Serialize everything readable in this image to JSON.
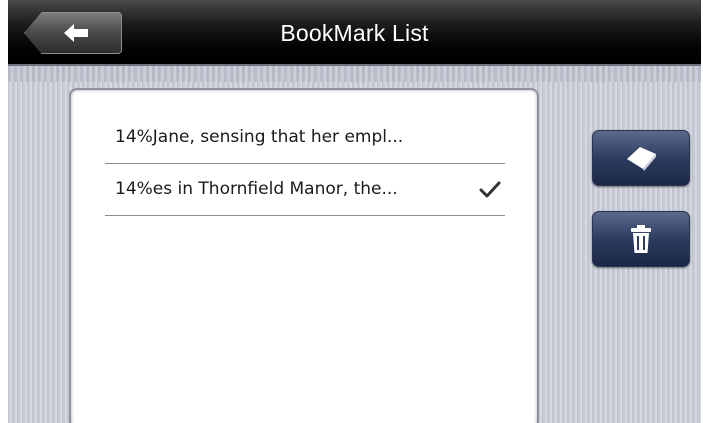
{
  "header": {
    "title": "BookMark List",
    "back_icon": "back-arrow-icon"
  },
  "bookmarks": [
    {
      "text": "14%Jane, sensing that her empl...",
      "checked": false
    },
    {
      "text": "14%es in Thornfield Manor, the...",
      "checked": true
    }
  ],
  "actions": {
    "add_icon": "bookmark-add-icon",
    "delete_icon": "trash-icon"
  },
  "colors": {
    "header_bg": "#000000",
    "button_blue": "#2d3c5f",
    "panel_bg": "#ffffff"
  }
}
